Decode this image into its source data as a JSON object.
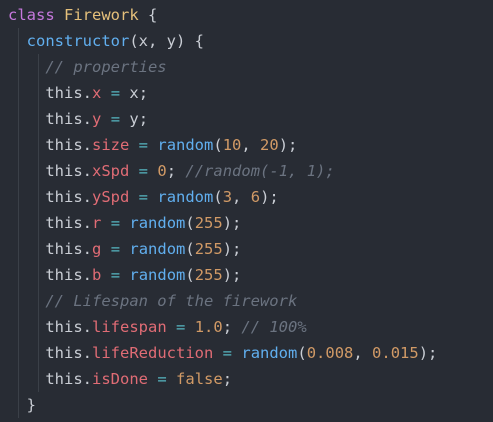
{
  "code": {
    "lines": [
      {
        "indent": 0,
        "tokens": [
          {
            "t": "class",
            "c": "kw"
          },
          {
            "t": " ",
            "c": "pl"
          },
          {
            "t": "Firework",
            "c": "cls"
          },
          {
            "t": " {",
            "c": "pl"
          }
        ]
      },
      {
        "indent": 1,
        "tokens": [
          {
            "t": "constructor",
            "c": "fn"
          },
          {
            "t": "(x, y) {",
            "c": "pl"
          }
        ]
      },
      {
        "indent": 2,
        "tokens": [
          {
            "t": "// properties",
            "c": "cm"
          }
        ]
      },
      {
        "indent": 2,
        "tokens": [
          {
            "t": "this",
            "c": "this"
          },
          {
            "t": ".",
            "c": "pl"
          },
          {
            "t": "x",
            "c": "prop"
          },
          {
            "t": " ",
            "c": "pl"
          },
          {
            "t": "=",
            "c": "op"
          },
          {
            "t": " x;",
            "c": "pl"
          }
        ]
      },
      {
        "indent": 2,
        "tokens": [
          {
            "t": "this",
            "c": "this"
          },
          {
            "t": ".",
            "c": "pl"
          },
          {
            "t": "y",
            "c": "prop"
          },
          {
            "t": " ",
            "c": "pl"
          },
          {
            "t": "=",
            "c": "op"
          },
          {
            "t": " y;",
            "c": "pl"
          }
        ]
      },
      {
        "indent": 2,
        "tokens": [
          {
            "t": "this",
            "c": "this"
          },
          {
            "t": ".",
            "c": "pl"
          },
          {
            "t": "size",
            "c": "prop"
          },
          {
            "t": " ",
            "c": "pl"
          },
          {
            "t": "=",
            "c": "op"
          },
          {
            "t": " ",
            "c": "pl"
          },
          {
            "t": "random",
            "c": "fn"
          },
          {
            "t": "(",
            "c": "pl"
          },
          {
            "t": "10",
            "c": "num"
          },
          {
            "t": ", ",
            "c": "pl"
          },
          {
            "t": "20",
            "c": "num"
          },
          {
            "t": ");",
            "c": "pl"
          }
        ]
      },
      {
        "indent": 2,
        "tokens": [
          {
            "t": "this",
            "c": "this"
          },
          {
            "t": ".",
            "c": "pl"
          },
          {
            "t": "xSpd",
            "c": "prop"
          },
          {
            "t": " ",
            "c": "pl"
          },
          {
            "t": "=",
            "c": "op"
          },
          {
            "t": " ",
            "c": "pl"
          },
          {
            "t": "0",
            "c": "num"
          },
          {
            "t": "; ",
            "c": "pl"
          },
          {
            "t": "//random(-1, 1);",
            "c": "cm"
          }
        ]
      },
      {
        "indent": 2,
        "tokens": [
          {
            "t": "this",
            "c": "this"
          },
          {
            "t": ".",
            "c": "pl"
          },
          {
            "t": "ySpd",
            "c": "prop"
          },
          {
            "t": " ",
            "c": "pl"
          },
          {
            "t": "=",
            "c": "op"
          },
          {
            "t": " ",
            "c": "pl"
          },
          {
            "t": "random",
            "c": "fn"
          },
          {
            "t": "(",
            "c": "pl"
          },
          {
            "t": "3",
            "c": "num"
          },
          {
            "t": ", ",
            "c": "pl"
          },
          {
            "t": "6",
            "c": "num"
          },
          {
            "t": ");",
            "c": "pl"
          }
        ]
      },
      {
        "indent": 2,
        "tokens": [
          {
            "t": "this",
            "c": "this"
          },
          {
            "t": ".",
            "c": "pl"
          },
          {
            "t": "r",
            "c": "prop"
          },
          {
            "t": " ",
            "c": "pl"
          },
          {
            "t": "=",
            "c": "op"
          },
          {
            "t": " ",
            "c": "pl"
          },
          {
            "t": "random",
            "c": "fn"
          },
          {
            "t": "(",
            "c": "pl"
          },
          {
            "t": "255",
            "c": "num"
          },
          {
            "t": ");",
            "c": "pl"
          }
        ]
      },
      {
        "indent": 2,
        "tokens": [
          {
            "t": "this",
            "c": "this"
          },
          {
            "t": ".",
            "c": "pl"
          },
          {
            "t": "g",
            "c": "prop"
          },
          {
            "t": " ",
            "c": "pl"
          },
          {
            "t": "=",
            "c": "op"
          },
          {
            "t": " ",
            "c": "pl"
          },
          {
            "t": "random",
            "c": "fn"
          },
          {
            "t": "(",
            "c": "pl"
          },
          {
            "t": "255",
            "c": "num"
          },
          {
            "t": ");",
            "c": "pl"
          }
        ]
      },
      {
        "indent": 2,
        "tokens": [
          {
            "t": "this",
            "c": "this"
          },
          {
            "t": ".",
            "c": "pl"
          },
          {
            "t": "b",
            "c": "prop"
          },
          {
            "t": " ",
            "c": "pl"
          },
          {
            "t": "=",
            "c": "op"
          },
          {
            "t": " ",
            "c": "pl"
          },
          {
            "t": "random",
            "c": "fn"
          },
          {
            "t": "(",
            "c": "pl"
          },
          {
            "t": "255",
            "c": "num"
          },
          {
            "t": ");",
            "c": "pl"
          }
        ]
      },
      {
        "indent": 2,
        "tokens": [
          {
            "t": "// Lifespan of the firework",
            "c": "cm"
          }
        ]
      },
      {
        "indent": 2,
        "tokens": [
          {
            "t": "this",
            "c": "this"
          },
          {
            "t": ".",
            "c": "pl"
          },
          {
            "t": "lifespan",
            "c": "prop"
          },
          {
            "t": " ",
            "c": "pl"
          },
          {
            "t": "=",
            "c": "op"
          },
          {
            "t": " ",
            "c": "pl"
          },
          {
            "t": "1.0",
            "c": "num"
          },
          {
            "t": "; ",
            "c": "pl"
          },
          {
            "t": "// 100%",
            "c": "cm"
          }
        ]
      },
      {
        "indent": 2,
        "tokens": [
          {
            "t": "this",
            "c": "this"
          },
          {
            "t": ".",
            "c": "pl"
          },
          {
            "t": "lifeReduction",
            "c": "prop"
          },
          {
            "t": " ",
            "c": "pl"
          },
          {
            "t": "=",
            "c": "op"
          },
          {
            "t": " ",
            "c": "pl"
          },
          {
            "t": "random",
            "c": "fn"
          },
          {
            "t": "(",
            "c": "pl"
          },
          {
            "t": "0.008",
            "c": "num"
          },
          {
            "t": ", ",
            "c": "pl"
          },
          {
            "t": "0.015",
            "c": "num"
          },
          {
            "t": ");",
            "c": "pl"
          }
        ]
      },
      {
        "indent": 2,
        "tokens": [
          {
            "t": "this",
            "c": "this"
          },
          {
            "t": ".",
            "c": "pl"
          },
          {
            "t": "isDone",
            "c": "prop"
          },
          {
            "t": " ",
            "c": "pl"
          },
          {
            "t": "=",
            "c": "op"
          },
          {
            "t": " ",
            "c": "pl"
          },
          {
            "t": "false",
            "c": "bool"
          },
          {
            "t": ";",
            "c": "pl"
          }
        ]
      },
      {
        "indent": 1,
        "tokens": [
          {
            "t": "}",
            "c": "pl"
          }
        ]
      }
    ]
  },
  "theme": {
    "background": "#282c34",
    "keyword": "#c678dd",
    "class_name": "#e5c07b",
    "function": "#61afef",
    "property": "#e06c75",
    "number": "#d19a66",
    "operator": "#56b6c2",
    "comment": "#6b7380",
    "plain": "#c9cdd4"
  }
}
